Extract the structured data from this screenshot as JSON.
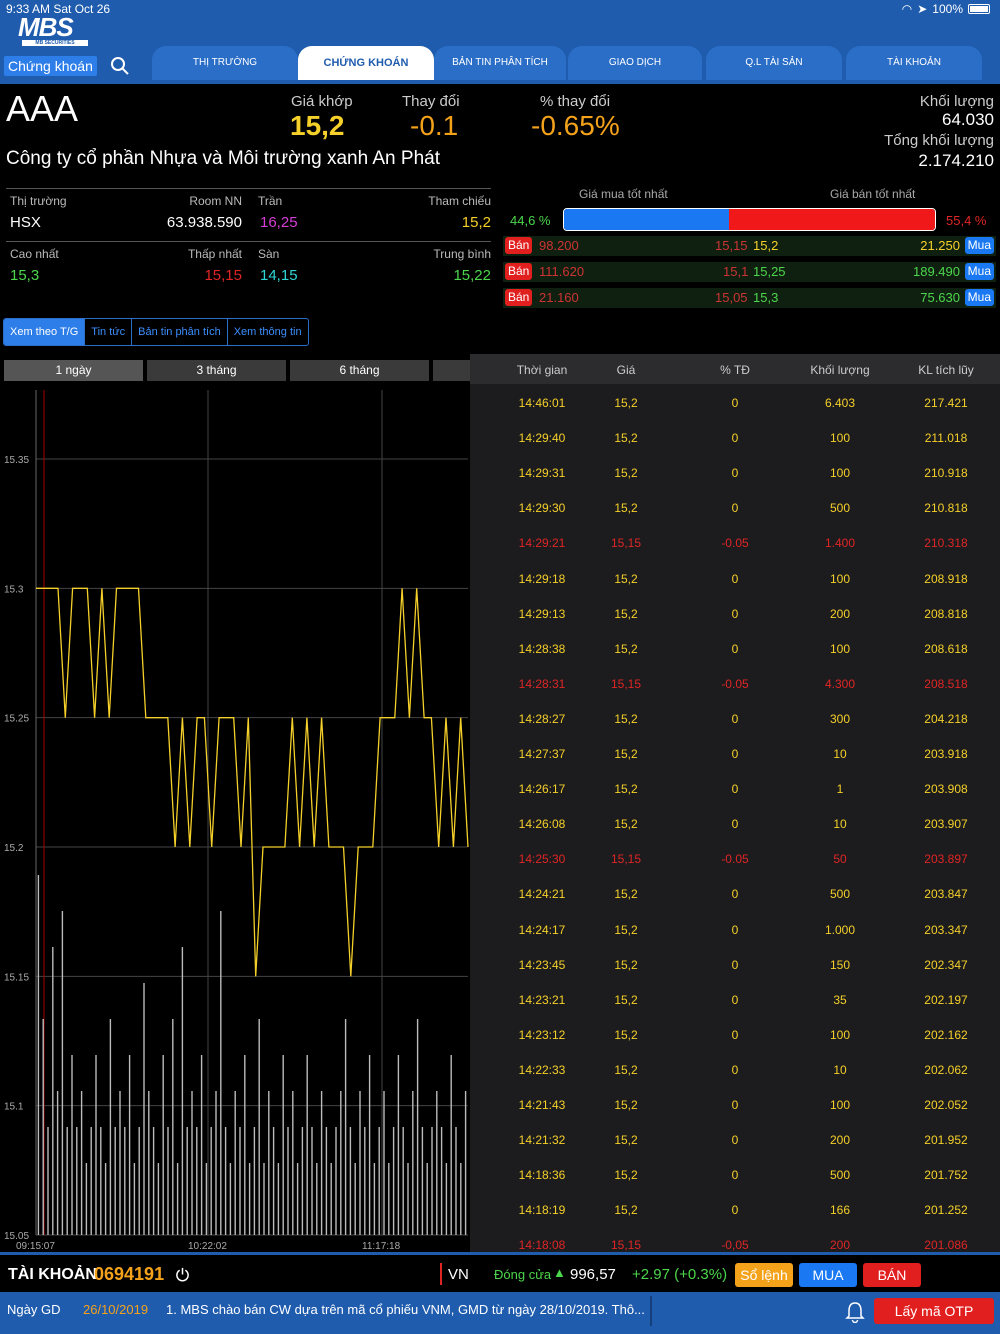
{
  "status_bar": {
    "time": "9:33 AM  Sat Oct 26",
    "battery": "100%"
  },
  "header": {
    "logo_text": "MBS",
    "logo_sub": "MB SECURITIES",
    "section_label": "Chứng khoán",
    "tabs": [
      "THỊ TRƯỜNG",
      "CHỨNG KHOÁN",
      "BẢN TIN PHÂN TÍCH",
      "GIAO DỊCH",
      "Q.L TÀI SẢN",
      "TÀI KHOẢN"
    ],
    "active_tab": "CHỨNG KHOÁN"
  },
  "quote": {
    "symbol": "AAA",
    "company": "Công ty cổ phần Nhựa và Môi trường xanh An Phát",
    "match_price_label": "Giá khớp",
    "match_price": "15,2",
    "change_label": "Thay đổi",
    "change": "-0.1",
    "pct_change_label": "% thay đổi",
    "pct_change": "-0.65%",
    "volume_label": "Khối lượng",
    "volume": "64.030",
    "total_volume_label": "Tổng khối lượng",
    "total_volume": "2.174.210"
  },
  "info": {
    "market_label": "Thị trường",
    "market": "HSX",
    "foreign_room_label": "Room NN",
    "foreign_room": "63.938.590",
    "ceiling_label": "Trần",
    "ceiling": "16,25",
    "reference_label": "Tham chiếu",
    "reference": "15,2",
    "high_label": "Cao nhất",
    "high": "15,3",
    "low_label": "Thấp nhất",
    "low": "15,15",
    "floor_label": "Sàn",
    "floor": "14,15",
    "average_label": "Trung bình",
    "average": "15,22"
  },
  "orderbook": {
    "best_bid_label": "Giá mua tốt nhất",
    "best_ask_label": "Giá bán tốt nhất",
    "bid_pct": "44,6 %",
    "ask_pct": "55,4 %",
    "bid_fraction": 0.446,
    "sell_badge": "Bán",
    "buy_badge": "Mua",
    "rows": [
      {
        "bid_vol": "98.200",
        "bid_price": "15,15",
        "ask_price": "15,2",
        "ask_vol": "21.250"
      },
      {
        "bid_vol": "111.620",
        "bid_price": "15,1",
        "ask_price": "15,25",
        "ask_vol": "189.490"
      },
      {
        "bid_vol": "21.160",
        "bid_price": "15,05",
        "ask_price": "15,3",
        "ask_vol": "75.630"
      }
    ]
  },
  "subtabs": [
    "Xem theo T/G",
    "Tin tức",
    "Bản tin phân tích",
    "Xem thông tin"
  ],
  "periods": [
    "1 ngày",
    "3 tháng",
    "6 tháng"
  ],
  "chart_data": {
    "type": "line",
    "y_ticks": [
      "15.35",
      "15.3",
      "15.25",
      "15.2",
      "15.15",
      "15.1",
      "15.05"
    ],
    "x_ticks": [
      "09:15:07",
      "10:22:02",
      "11:17:18"
    ],
    "ylim": [
      15.05,
      15.35
    ],
    "series": [
      {
        "values": [
          15.3,
          15.3,
          15.3,
          15.3,
          15.25,
          15.3,
          15.3,
          15.3,
          15.25,
          15.3,
          15.25,
          15.3,
          15.3,
          15.3,
          15.3,
          15.25,
          15.25,
          15.25,
          15.25,
          15.2,
          15.25,
          15.2,
          15.25,
          15.25,
          15.2,
          15.25,
          15.25,
          15.25,
          15.2,
          15.25,
          15.15,
          15.2,
          15.2,
          15.2,
          15.2,
          15.25,
          15.2,
          15.25,
          15.2,
          15.25,
          15.2,
          15.2,
          15.2,
          15.15,
          15.2,
          15.2,
          15.2,
          15.25,
          15.25,
          15.25,
          15.3,
          15.25,
          15.3,
          15.25,
          15.25,
          15.2,
          15.25,
          15.2,
          15.25,
          15.2
        ]
      }
    ],
    "bars": [
      1.0,
      0.6,
      0.3,
      0.8,
      0.4,
      0.9,
      0.3,
      0.5,
      0.3,
      0.4,
      0.2,
      0.3,
      0.5,
      0.3,
      0.2,
      0.6,
      0.3,
      0.4,
      0.3,
      0.5,
      0.2,
      0.3,
      0.7,
      0.4,
      0.3,
      0.2,
      0.5,
      0.3,
      0.6,
      0.2,
      0.8,
      0.3,
      0.4,
      0.3,
      0.5,
      0.2,
      0.3,
      0.4,
      0.9,
      0.3,
      0.2,
      0.4,
      0.3,
      0.5,
      0.2,
      0.3,
      0.6,
      0.2,
      0.4,
      0.3,
      0.2,
      0.5,
      0.3,
      0.4,
      0.2,
      0.3,
      0.5,
      0.3,
      0.2,
      0.4,
      0.3,
      0.2,
      0.3,
      0.4,
      0.6,
      0.3,
      0.2,
      0.4,
      0.3,
      0.5,
      0.2,
      0.3,
      0.4,
      0.2,
      0.3,
      0.5,
      0.3,
      0.2,
      0.4,
      0.6,
      0.3,
      0.2,
      0.3,
      0.4,
      0.3,
      0.2,
      0.5,
      0.3,
      0.2,
      0.4
    ]
  },
  "trades": {
    "headers": [
      "Thời gian",
      "Giá",
      "% TĐ",
      "Khối lượng",
      "KL tích lũy"
    ],
    "rows": [
      [
        "14:46:01",
        "15,2",
        "0",
        "6.403",
        "217.421"
      ],
      [
        "14:29:40",
        "15,2",
        "0",
        "100",
        "211.018"
      ],
      [
        "14:29:31",
        "15,2",
        "0",
        "100",
        "210.918"
      ],
      [
        "14:29:30",
        "15,2",
        "0",
        "500",
        "210.818"
      ],
      [
        "14:29:21",
        "15,15",
        "-0.05",
        "1.400",
        "210.318"
      ],
      [
        "14:29:18",
        "15,2",
        "0",
        "100",
        "208.918"
      ],
      [
        "14:29:13",
        "15,2",
        "0",
        "200",
        "208.818"
      ],
      [
        "14:28:38",
        "15,2",
        "0",
        "100",
        "208.618"
      ],
      [
        "14:28:31",
        "15,15",
        "-0.05",
        "4.300",
        "208.518"
      ],
      [
        "14:28:27",
        "15,2",
        "0",
        "300",
        "204.218"
      ],
      [
        "14:27:37",
        "15,2",
        "0",
        "10",
        "203.918"
      ],
      [
        "14:26:17",
        "15,2",
        "0",
        "1",
        "203.908"
      ],
      [
        "14:26:08",
        "15,2",
        "0",
        "10",
        "203.907"
      ],
      [
        "14:25:30",
        "15,15",
        "-0.05",
        "50",
        "203.897"
      ],
      [
        "14:24:21",
        "15,2",
        "0",
        "500",
        "203.847"
      ],
      [
        "14:24:17",
        "15,2",
        "0",
        "1.000",
        "203.347"
      ],
      [
        "14:23:45",
        "15,2",
        "0",
        "150",
        "202.347"
      ],
      [
        "14:23:21",
        "15,2",
        "0",
        "35",
        "202.197"
      ],
      [
        "14:23:12",
        "15,2",
        "0",
        "100",
        "202.162"
      ],
      [
        "14:22:33",
        "15,2",
        "0",
        "10",
        "202.062"
      ],
      [
        "14:21:43",
        "15,2",
        "0",
        "100",
        "202.052"
      ],
      [
        "14:21:32",
        "15,2",
        "0",
        "200",
        "201.952"
      ],
      [
        "14:18:36",
        "15,2",
        "0",
        "500",
        "201.752"
      ],
      [
        "14:18:19",
        "15,2",
        "0",
        "166",
        "201.252"
      ],
      [
        "14:18:08",
        "15,15",
        "-0,05",
        "200",
        "201.086"
      ]
    ]
  },
  "account": {
    "label": "TÀI KHOẢN",
    "number": "0694191",
    "market": "VN",
    "close_label": "Đóng cửa",
    "index_value": "996,57",
    "index_change": "+2.97 (+0.3%)",
    "order_book_btn": "Sổ lệnh",
    "buy_btn": "MUA",
    "sell_btn": "BÁN"
  },
  "news": {
    "date_label": "Ngày GD",
    "date": "26/10/2019",
    "headline": "1. MBS chào bán CW dựa trên mã cổ phiếu VNM, GMD từ ngày 28/10/2019. Thô...",
    "otp_btn": "Lấy mã OTP"
  },
  "colors": {
    "header": "#1f5cae",
    "price_up": "#f5d02a",
    "price_down": "#e02525",
    "buy": "#1a78f2",
    "sell": "#f01818"
  }
}
